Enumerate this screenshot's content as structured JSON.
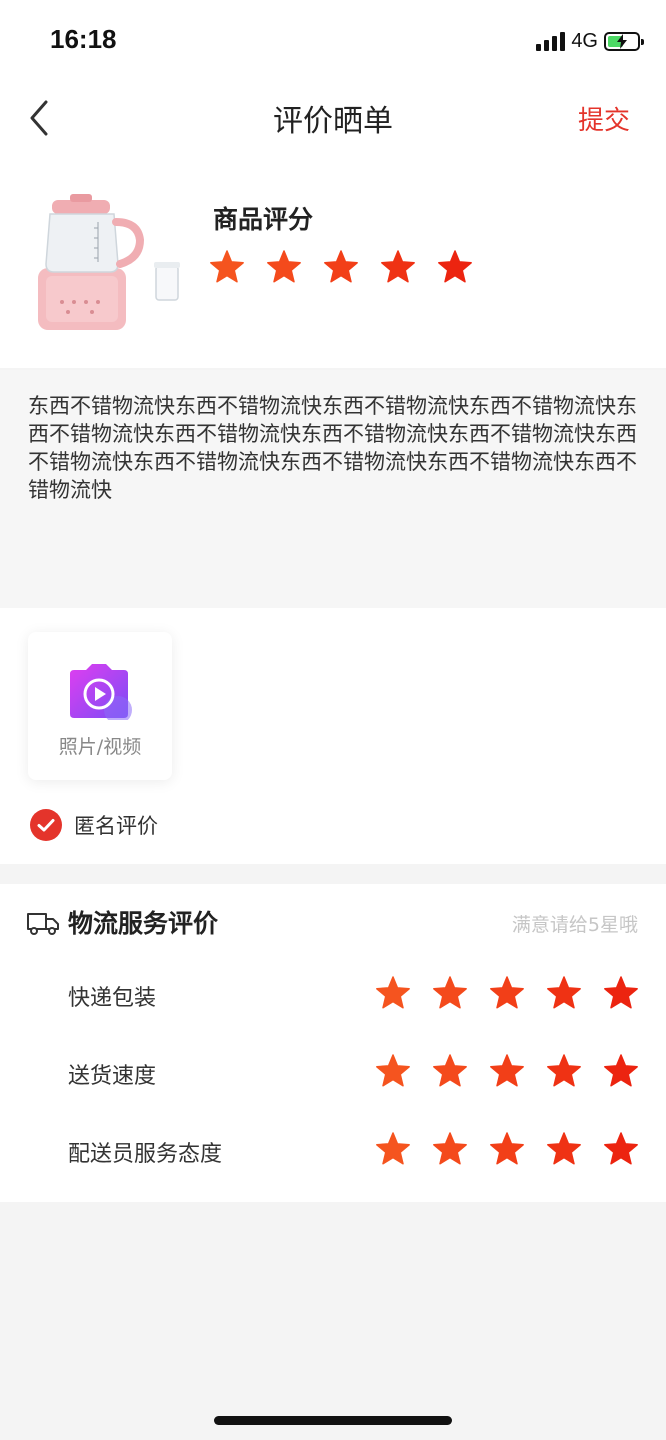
{
  "status_bar": {
    "time": "16:18",
    "network": "4G"
  },
  "nav": {
    "title": "评价晒单",
    "submit_label": "提交"
  },
  "product": {
    "rating_label": "商品评分",
    "rating": 5,
    "max_rating": 5
  },
  "review": {
    "text": "东西不错物流快东西不错物流快东西不错物流快东西不错物流快东西不错物流快东西不错物流快东西不错物流快东西不错物流快东西不错物流快东西不错物流快东西不错物流快东西不错物流快东西不错物流快"
  },
  "media": {
    "upload_label": "照片/视频",
    "anonymous_label": "匿名评价",
    "anonymous_checked": true
  },
  "logistics": {
    "title": "物流服务评价",
    "hint": "满意请给5星哦",
    "items": [
      {
        "label": "快递包装",
        "rating": 5
      },
      {
        "label": "送货速度",
        "rating": 5
      },
      {
        "label": "配送员服务态度",
        "rating": 5
      }
    ]
  },
  "colors": {
    "accent": "#e4342b",
    "star_colors": [
      "#f5541f",
      "#f44a1c",
      "#f23f18",
      "#ef3214",
      "#ec2410"
    ]
  },
  "icons": {
    "back": "chevron-left-icon",
    "upload": "camera-video-icon",
    "check": "check-circle-icon",
    "truck": "truck-icon",
    "star": "star-icon"
  }
}
